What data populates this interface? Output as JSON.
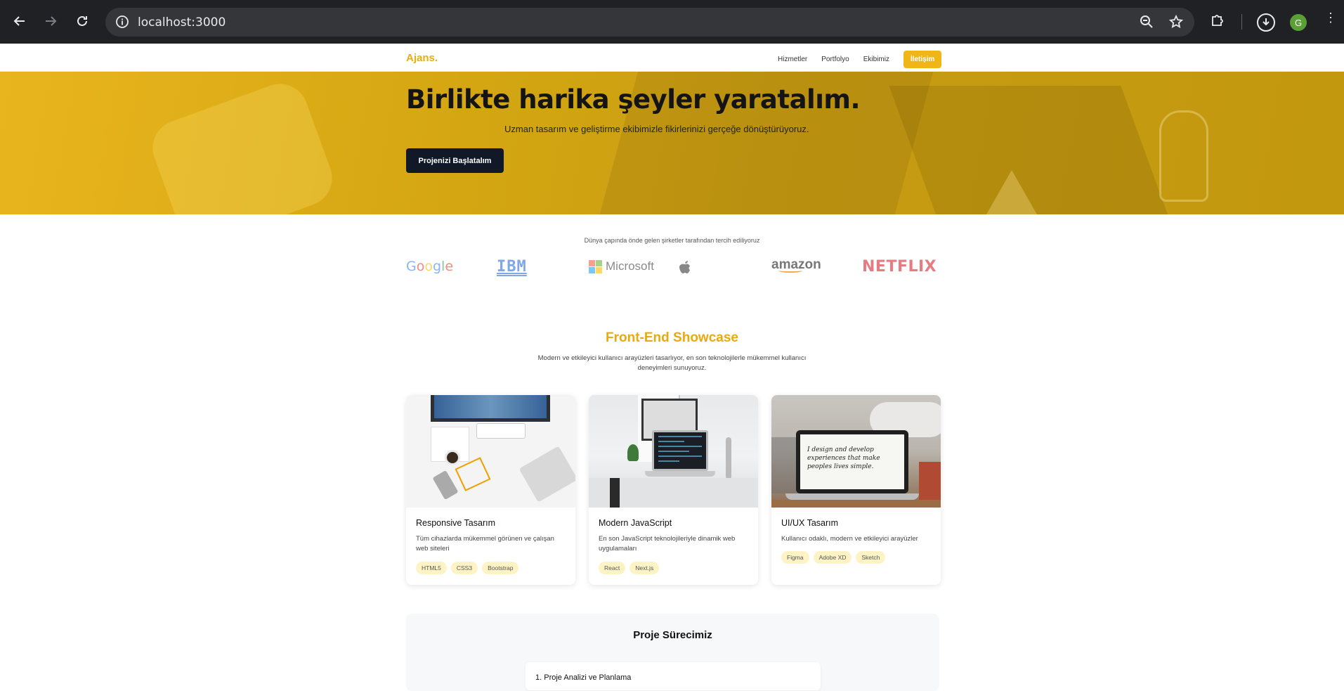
{
  "browser": {
    "url": "localhost:3000",
    "profile_initial": "G"
  },
  "nav": {
    "logo": "Ajans.",
    "links": [
      "Hizmetler",
      "Portfolyo",
      "Ekibimiz"
    ],
    "cta": "İletişim",
    "accent_color": "#f0b618"
  },
  "hero": {
    "title": "Birlikte harika şeyler yaratalım.",
    "subtitle": "Uzman tasarım ve geliştirme ekibimizle fikirlerinizi gerçeğe dönüştürüyoruz.",
    "button": "Projenizi Başlatalım"
  },
  "clients": {
    "caption": "Dünya çapında önde gelen şirketler tarafından tercih ediliyoruz",
    "logos": [
      "Google",
      "IBM",
      "Microsoft",
      "Apple",
      "amazon",
      "NETFLIX"
    ]
  },
  "showcase": {
    "title": "Front-End Showcase",
    "description": "Modern ve etkileyici kullanıcı arayüzleri tasarlıyor, en son teknolojilerle mükemmel kullanıcı deneyimleri sunuyoruz.",
    "cards": [
      {
        "title": "Responsive Tasarım",
        "text": "Tüm cihazlarda mükemmel görünen ve çalışan web siteleri",
        "tags": [
          "HTML5",
          "CSS3",
          "Bootstrap"
        ]
      },
      {
        "title": "Modern JavaScript",
        "text": "En son JavaScript teknolojileriyle dinamik web uygulamaları",
        "tags": [
          "React",
          "Next.js"
        ]
      },
      {
        "title": "UI/UX Tasarım",
        "text": "Kullanıcı odaklı, modern ve etkileyici arayüzler",
        "tags": [
          "Figma",
          "Adobe XD",
          "Sketch"
        ],
        "screen_text": "I design and develop experiences that make peoples lives simple."
      }
    ]
  },
  "process": {
    "title": "Proje Sürecimiz",
    "first_step": "1. Proje Analizi ve Planlama"
  }
}
